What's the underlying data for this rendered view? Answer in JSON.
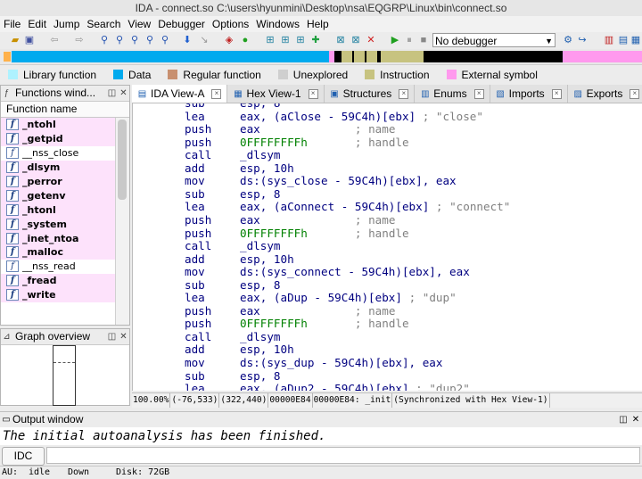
{
  "window": {
    "title": "IDA - connect.so C:\\users\\hyunmini\\Desktop\\nsa\\EQGRP\\Linux\\bin\\connect.so"
  },
  "menu": [
    "File",
    "Edit",
    "Jump",
    "Search",
    "View",
    "Debugger",
    "Options",
    "Windows",
    "Help"
  ],
  "toolbar": {
    "debugger_select": "No debugger"
  },
  "legend": [
    {
      "label": "Library function",
      "color": "#aef2ff"
    },
    {
      "label": "Data",
      "color": "#00aaee"
    },
    {
      "label": "Regular function",
      "color": "#c89070"
    },
    {
      "label": "Unexplored",
      "color": "#cfcfcf"
    },
    {
      "label": "Instruction",
      "color": "#c7c380"
    },
    {
      "label": "External symbol",
      "color": "#ff99ee"
    }
  ],
  "functions_panel": {
    "title": "Functions wind...",
    "column_header": "Function name",
    "functions": [
      {
        "name": "_ntohl",
        "kind": "lib"
      },
      {
        "name": "_getpid",
        "kind": "lib"
      },
      {
        "name": "__nss_close",
        "kind": "reg"
      },
      {
        "name": "_dlsym",
        "kind": "lib"
      },
      {
        "name": "_perror",
        "kind": "lib"
      },
      {
        "name": "_getenv",
        "kind": "lib"
      },
      {
        "name": "_htonl",
        "kind": "lib"
      },
      {
        "name": "_system",
        "kind": "lib"
      },
      {
        "name": "_inet_ntoa",
        "kind": "lib"
      },
      {
        "name": "_malloc",
        "kind": "lib"
      },
      {
        "name": "__nss_read",
        "kind": "reg"
      },
      {
        "name": "_fread",
        "kind": "lib"
      },
      {
        "name": "_write",
        "kind": "lib"
      }
    ]
  },
  "graph_panel": {
    "title": "Graph overview"
  },
  "tabs": [
    {
      "label": "IDA View-A",
      "active": true
    },
    {
      "label": "Hex View-1",
      "active": false
    },
    {
      "label": "Structures",
      "active": false
    },
    {
      "label": "Enums",
      "active": false
    },
    {
      "label": "Imports",
      "active": false
    },
    {
      "label": "Exports",
      "active": false
    }
  ],
  "disassembly": [
    {
      "mn": "sub",
      "op": "esp, 8",
      "cm": ""
    },
    {
      "mn": "lea",
      "op": "eax, (aClose - 59C4h)[ebx]",
      "cm": "; \"close\""
    },
    {
      "mn": "push",
      "op": "eax             ",
      "cm": "; name"
    },
    {
      "mn": "push",
      "op": "0FFFFFFFFh      ",
      "cm": "; handle"
    },
    {
      "mn": "call",
      "op": "_dlsym",
      "cm": ""
    },
    {
      "mn": "add",
      "op": "esp, 10h",
      "cm": ""
    },
    {
      "mn": "mov",
      "op": "ds:(sys_close - 59C4h)[ebx], eax",
      "cm": ""
    },
    {
      "mn": "sub",
      "op": "esp, 8",
      "cm": ""
    },
    {
      "mn": "lea",
      "op": "eax, (aConnect - 59C4h)[ebx]",
      "cm": "; \"connect\""
    },
    {
      "mn": "push",
      "op": "eax             ",
      "cm": "; name"
    },
    {
      "mn": "push",
      "op": "0FFFFFFFFh      ",
      "cm": "; handle"
    },
    {
      "mn": "call",
      "op": "_dlsym",
      "cm": ""
    },
    {
      "mn": "add",
      "op": "esp, 10h",
      "cm": ""
    },
    {
      "mn": "mov",
      "op": "ds:(sys_connect - 59C4h)[ebx], eax",
      "cm": ""
    },
    {
      "mn": "sub",
      "op": "esp, 8",
      "cm": ""
    },
    {
      "mn": "lea",
      "op": "eax, (aDup - 59C4h)[ebx]",
      "cm": "; \"dup\""
    },
    {
      "mn": "push",
      "op": "eax             ",
      "cm": "; name"
    },
    {
      "mn": "push",
      "op": "0FFFFFFFFh      ",
      "cm": "; handle"
    },
    {
      "mn": "call",
      "op": "_dlsym",
      "cm": ""
    },
    {
      "mn": "add",
      "op": "esp, 10h",
      "cm": ""
    },
    {
      "mn": "mov",
      "op": "ds:(sys_dup - 59C4h)[ebx], eax",
      "cm": ""
    },
    {
      "mn": "sub",
      "op": "esp, 8",
      "cm": ""
    },
    {
      "mn": "lea",
      "op": "eax, (aDup2 - 59C4h)[ebx]",
      "cm": "; \"dup2\""
    }
  ],
  "disasm_status": [
    "100.00%",
    "(-76,533)",
    "(322,440)",
    "00000E84",
    "00000E84: _init",
    "(Synchronized with Hex View-1)"
  ],
  "output": {
    "title": "Output window",
    "text": "The initial autoanalysis has been finished."
  },
  "idc": {
    "button_label": "IDC"
  },
  "statusbar": {
    "au": "AU:",
    "state": "idle",
    "direction": "Down",
    "disk": "Disk: 72GB"
  }
}
